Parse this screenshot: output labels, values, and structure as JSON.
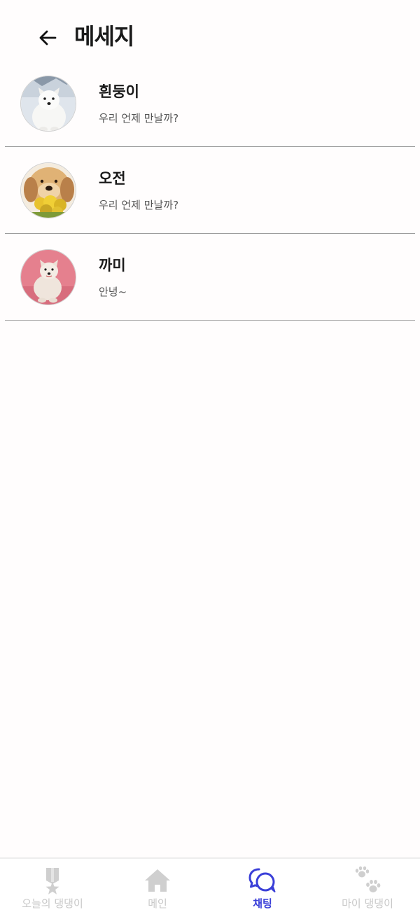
{
  "header": {
    "title": "메세지"
  },
  "chats": [
    {
      "name": "흰둥이",
      "preview": "우리 언제 만날까?"
    },
    {
      "name": "오전",
      "preview": "우리 언제 만날까?"
    },
    {
      "name": "까미",
      "preview": "안녕~"
    }
  ],
  "nav": {
    "items": [
      {
        "label": "오늘의 댕댕이",
        "icon": "medal-icon",
        "active": false
      },
      {
        "label": "메인",
        "icon": "home-icon",
        "active": false
      },
      {
        "label": "채팅",
        "icon": "chat-bubbles-icon",
        "active": true
      },
      {
        "label": "마이 댕댕이",
        "icon": "paw-icon",
        "active": false
      }
    ]
  },
  "colors": {
    "accent": "#3a3fd8",
    "inactive": "#c8c8c8",
    "divider": "#9a9a9a"
  }
}
